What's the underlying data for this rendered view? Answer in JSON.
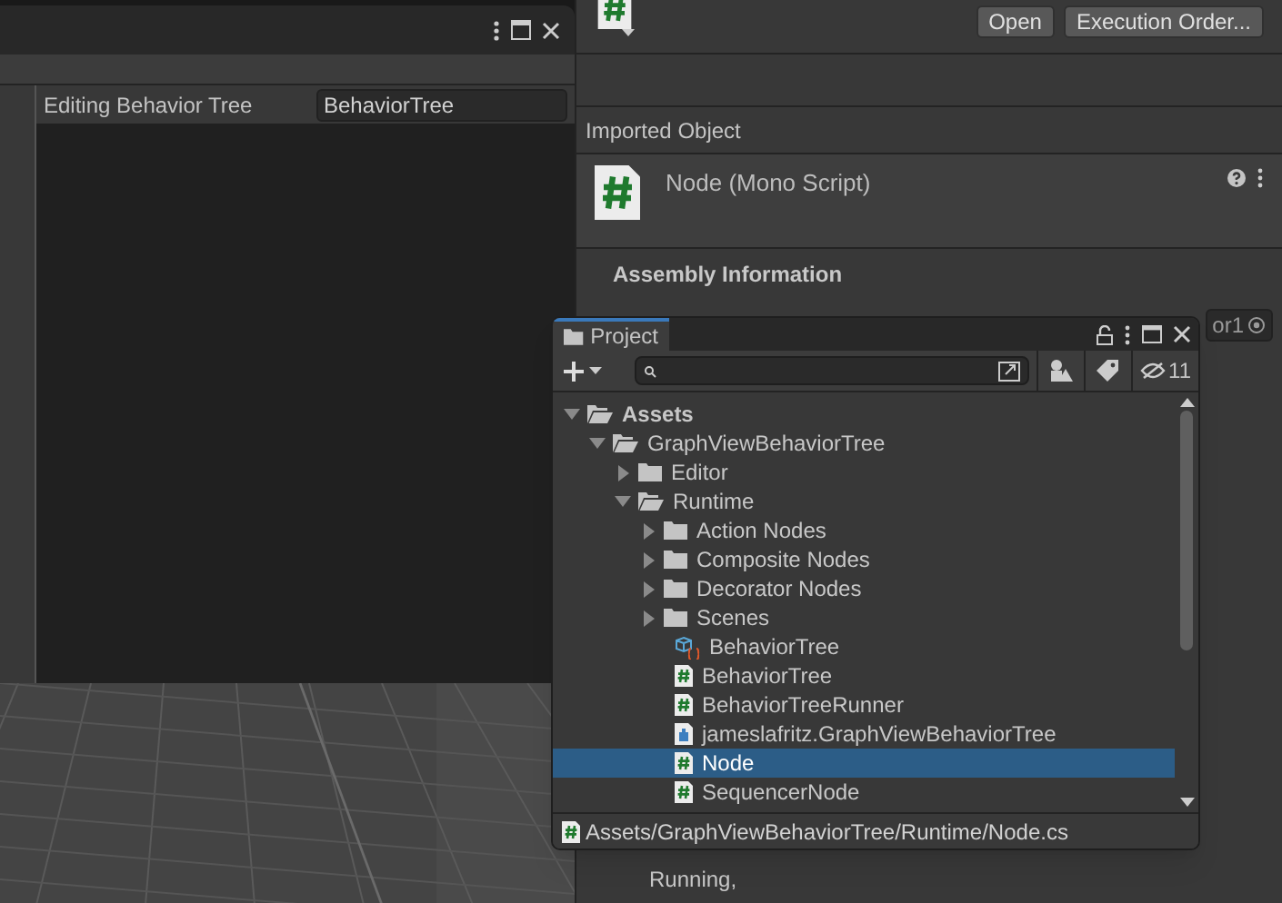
{
  "editor_window": {
    "property": {
      "label": "Editing Behavior Tree",
      "value": "BehaviorTree"
    }
  },
  "inspector": {
    "buttons": [
      "Open",
      "Execution Order..."
    ],
    "section_title": "Imported Object",
    "asset_title": "Node (Mono Script)",
    "assembly_heading": "Assembly Information",
    "field_partial": "or1",
    "code_lines": [
      "Running,"
    ]
  },
  "project": {
    "tab": "Project",
    "hidden_count": "11",
    "tree": [
      {
        "label": "Assets",
        "kind": "folder",
        "expanded": true,
        "selected": false,
        "children": [
          {
            "label": "GraphViewBehaviorTree",
            "kind": "folder",
            "expanded": true,
            "selected": false,
            "children": [
              {
                "label": "Editor",
                "kind": "folder",
                "expanded": false,
                "selected": false
              },
              {
                "label": "Runtime",
                "kind": "folder",
                "expanded": true,
                "selected": false,
                "children": [
                  {
                    "label": "Action Nodes",
                    "kind": "folder",
                    "expanded": false,
                    "selected": false
                  },
                  {
                    "label": "Composite Nodes",
                    "kind": "folder",
                    "expanded": false,
                    "selected": false
                  },
                  {
                    "label": "Decorator Nodes",
                    "kind": "folder",
                    "expanded": false,
                    "selected": false
                  },
                  {
                    "label": "Scenes",
                    "kind": "folder",
                    "expanded": false,
                    "selected": false
                  },
                  {
                    "label": "BehaviorTree",
                    "kind": "asset",
                    "selected": false
                  },
                  {
                    "label": "BehaviorTree",
                    "kind": "script",
                    "selected": false
                  },
                  {
                    "label": "BehaviorTreeRunner",
                    "kind": "script",
                    "selected": false
                  },
                  {
                    "label": "jameslafritz.GraphViewBehaviorTree",
                    "kind": "assembly",
                    "selected": false
                  },
                  {
                    "label": "Node",
                    "kind": "script",
                    "selected": true
                  },
                  {
                    "label": "SequencerNode",
                    "kind": "script",
                    "selected": false
                  }
                ]
              }
            ]
          }
        ]
      }
    ],
    "status_path": "Assets/GraphViewBehaviorTree/Runtime/Node.cs"
  }
}
